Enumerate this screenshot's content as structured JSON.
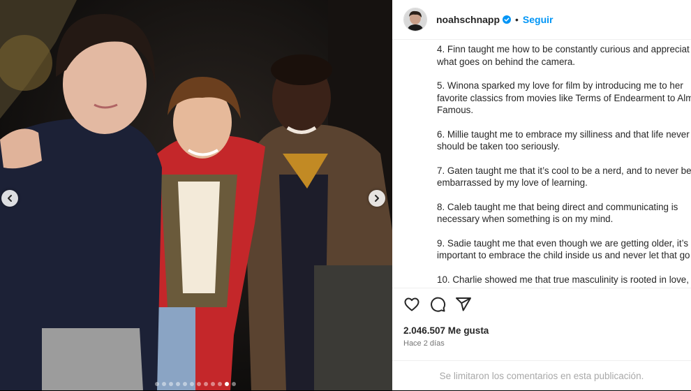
{
  "colors": {
    "accent": "#0095f6",
    "text": "#262626",
    "muted": "#737373",
    "disabled_text": "#a8a8a8"
  },
  "media": {
    "description_icon": "photo-of-three-boys",
    "carousel_total": 12,
    "carousel_active_index": 10,
    "prev_icon": "chevron-left-icon",
    "next_icon": "chevron-right-icon"
  },
  "header": {
    "username": "noahschnapp",
    "verified_icon": "verified-badge-icon",
    "separator": "•",
    "follow_label": "Seguir"
  },
  "caption": {
    "lines": [
      "4. Finn taught me how to be constantly curious and appreciat",
      "what goes on behind the camera.",
      "5. Winona sparked my love for film by introducing me to her",
      "favorite classics from movies like Terms of Endearment to Alm",
      "Famous.",
      "6. Millie taught me to embrace my silliness and that life never",
      "should be taken too seriously.",
      "7. Gaten taught me that it’s cool to be a nerd, and to never be",
      "embarrassed by my love of learning.",
      "8. Caleb taught me that being direct and communicating is",
      "necessary when something is on my mind.",
      "9. Sadie taught me that even though we are getting older, it’s",
      "important to embrace the child inside us and never let that go",
      "10. Charlie showed me that true masculinity is rooted in love,"
    ]
  },
  "actions": {
    "like_icon": "heart-icon",
    "comment_icon": "comment-icon",
    "share_icon": "share-icon"
  },
  "likes_text": "2.046.507 Me gusta",
  "time_text": "Hace 2 días",
  "comments_disabled_text": "Se limitaron los comentarios en esta publicación."
}
